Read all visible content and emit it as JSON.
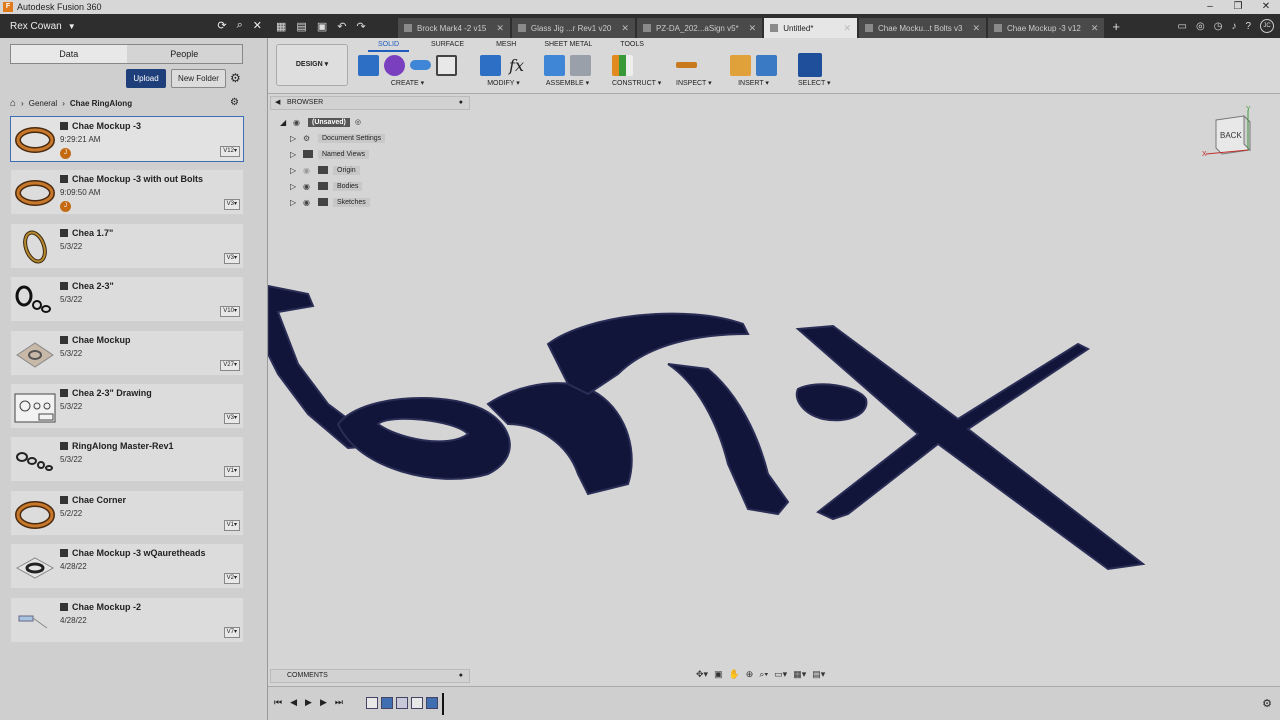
{
  "window": {
    "title": "Autodesk Fusion 360",
    "controls": [
      "–",
      "❐",
      "✕"
    ]
  },
  "topbar": {
    "user": "Rex Cowan",
    "tabs": [
      {
        "label": "Brock Mark4 -2 v15",
        "active": false
      },
      {
        "label": "Glass Jig ...r Rev1 v20",
        "active": false
      },
      {
        "label": "PZ-DA_202...aSign v5*",
        "active": false
      },
      {
        "label": "Untitled*",
        "active": true
      },
      {
        "label": "Chae Mocku...t Bolts v3",
        "active": false
      },
      {
        "label": "Chae Mockup -3 v12",
        "active": false
      }
    ],
    "avatar": "JC"
  },
  "data_panel": {
    "tabs": [
      "Data",
      "People"
    ],
    "upload_label": "Upload",
    "new_folder_label": "New Folder",
    "breadcrumb": [
      "General",
      "Chae RingAlong"
    ],
    "files": [
      {
        "name": "Chae Mockup -3",
        "date": "9:29:21 AM",
        "version": "V12",
        "badge": "J",
        "selected": true
      },
      {
        "name": "Chae Mockup -3 with out Bolts",
        "date": "9:09:50 AM",
        "version": "V3",
        "badge": "J",
        "selected": false
      },
      {
        "name": "Chea 1.7\"",
        "date": "5/3/22",
        "version": "V3",
        "badge": "",
        "selected": false
      },
      {
        "name": "Chea 2-3\"",
        "date": "5/3/22",
        "version": "V10",
        "badge": "",
        "selected": false
      },
      {
        "name": "Chae Mockup",
        "date": "5/3/22",
        "version": "V27",
        "badge": "",
        "selected": false
      },
      {
        "name": "Chea 2-3\" Drawing",
        "date": "5/3/22",
        "version": "V3",
        "badge": "",
        "selected": false
      },
      {
        "name": "RingAlong Master-Rev1",
        "date": "5/3/22",
        "version": "V1",
        "badge": "",
        "selected": false
      },
      {
        "name": "Chae Corner",
        "date": "5/2/22",
        "version": "V1",
        "badge": "",
        "selected": false
      },
      {
        "name": "Chae Mockup -3 wQauretheads",
        "date": "4/28/22",
        "version": "V2",
        "badge": "",
        "selected": false
      },
      {
        "name": "Chae Mockup -2",
        "date": "4/28/22",
        "version": "V7",
        "badge": "",
        "selected": false
      }
    ]
  },
  "ribbon": {
    "workspace": "DESIGN ▾",
    "tabs": [
      "SOLID",
      "SURFACE",
      "MESH",
      "SHEET METAL",
      "TOOLS"
    ],
    "groups": [
      "CREATE ▾",
      "MODIFY ▾",
      "ASSEMBLE ▾",
      "CONSTRUCT ▾",
      "INSPECT ▾",
      "INSERT ▾",
      "SELECT ▾"
    ]
  },
  "browser": {
    "title": "BROWSER",
    "root": "(Unsaved)",
    "items": [
      "Document Settings",
      "Named Views",
      "Origin",
      "Bodies",
      "Sketches"
    ]
  },
  "viewcube": {
    "face": "BACK",
    "axis_x": "X",
    "axis_y": "Y"
  },
  "comments": {
    "title": "COMMENTS"
  },
  "colors": {
    "accent": "#1d5cbf",
    "upload": "#1f3f7a",
    "model": "#12153a"
  }
}
